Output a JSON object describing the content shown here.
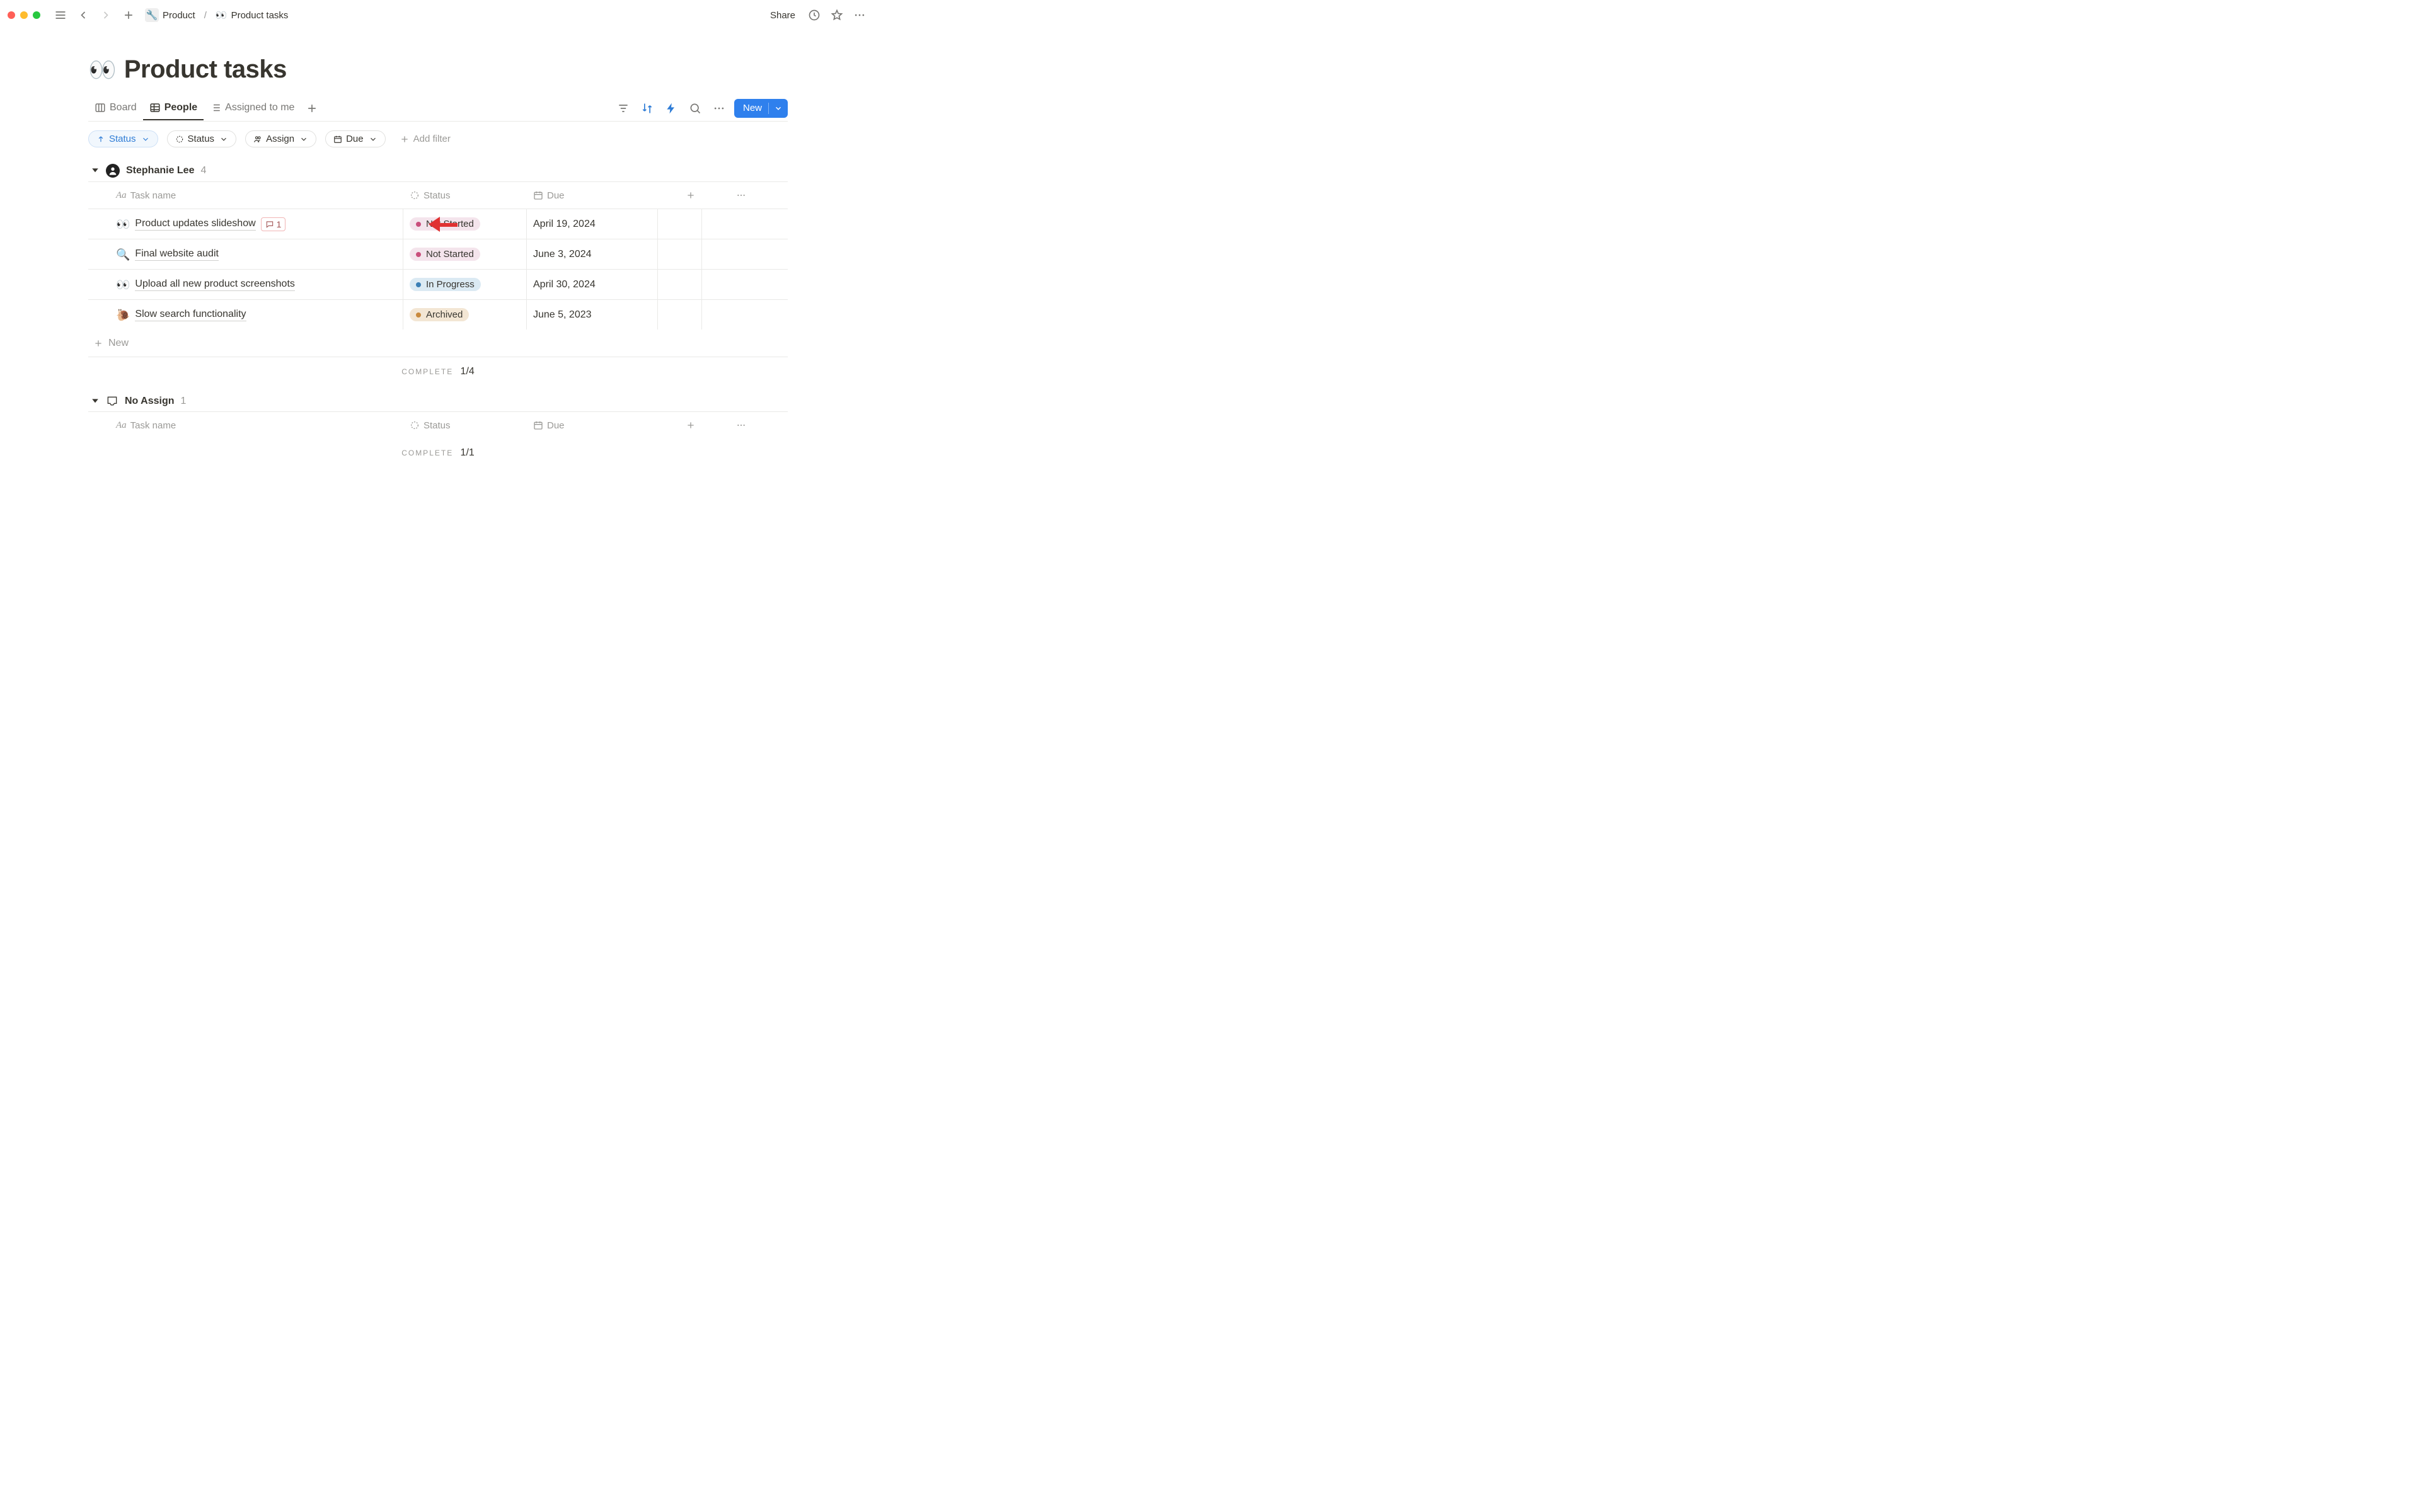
{
  "titlebar": {
    "breadcrumb": {
      "parent_icon": "🔧",
      "parent": "Product",
      "current_icon": "👀",
      "current": "Product tasks"
    },
    "share": "Share"
  },
  "page": {
    "icon": "👀",
    "title": "Product tasks"
  },
  "views": {
    "tabs": [
      {
        "label": "Board",
        "icon": "board"
      },
      {
        "label": "People",
        "icon": "table"
      },
      {
        "label": "Assigned to me",
        "icon": "list"
      }
    ],
    "active_index": 1,
    "new_button": "New"
  },
  "filters": {
    "sort": {
      "label": "Status",
      "direction": "asc"
    },
    "pills": [
      {
        "icon": "status",
        "label": "Status"
      },
      {
        "icon": "person",
        "label": "Assign"
      },
      {
        "icon": "calendar",
        "label": "Due"
      }
    ],
    "add_filter": "Add filter"
  },
  "columns": {
    "name": "Task name",
    "status": "Status",
    "due": "Due"
  },
  "groups": [
    {
      "icon": "avatar",
      "name": "Stephanie Lee",
      "count": 4,
      "rows": [
        {
          "emoji": "👀",
          "name": "Product updates slideshow",
          "comments": 1,
          "status": "Not Started",
          "status_class": "st-notstarted",
          "due": "April 19, 2024",
          "annotated": true
        },
        {
          "emoji": "🔍",
          "name": "Final website audit",
          "status": "Not Started",
          "status_class": "st-notstarted",
          "due": "June 3, 2024"
        },
        {
          "emoji": "👀",
          "name": "Upload all new product screenshots",
          "status": "In Progress",
          "status_class": "st-inprogress",
          "due": "April 30, 2024"
        },
        {
          "emoji": "🐌",
          "name": "Slow search functionality",
          "status": "Archived",
          "status_class": "st-archived",
          "due": "June 5, 2023"
        }
      ],
      "complete_label": "COMPLETE",
      "complete_fraction": "1/4",
      "new_row_label": "New"
    },
    {
      "icon": "tray",
      "name": "No Assign",
      "count": 1,
      "rows": [],
      "complete_label": "COMPLETE",
      "complete_fraction": "1/1"
    }
  ]
}
